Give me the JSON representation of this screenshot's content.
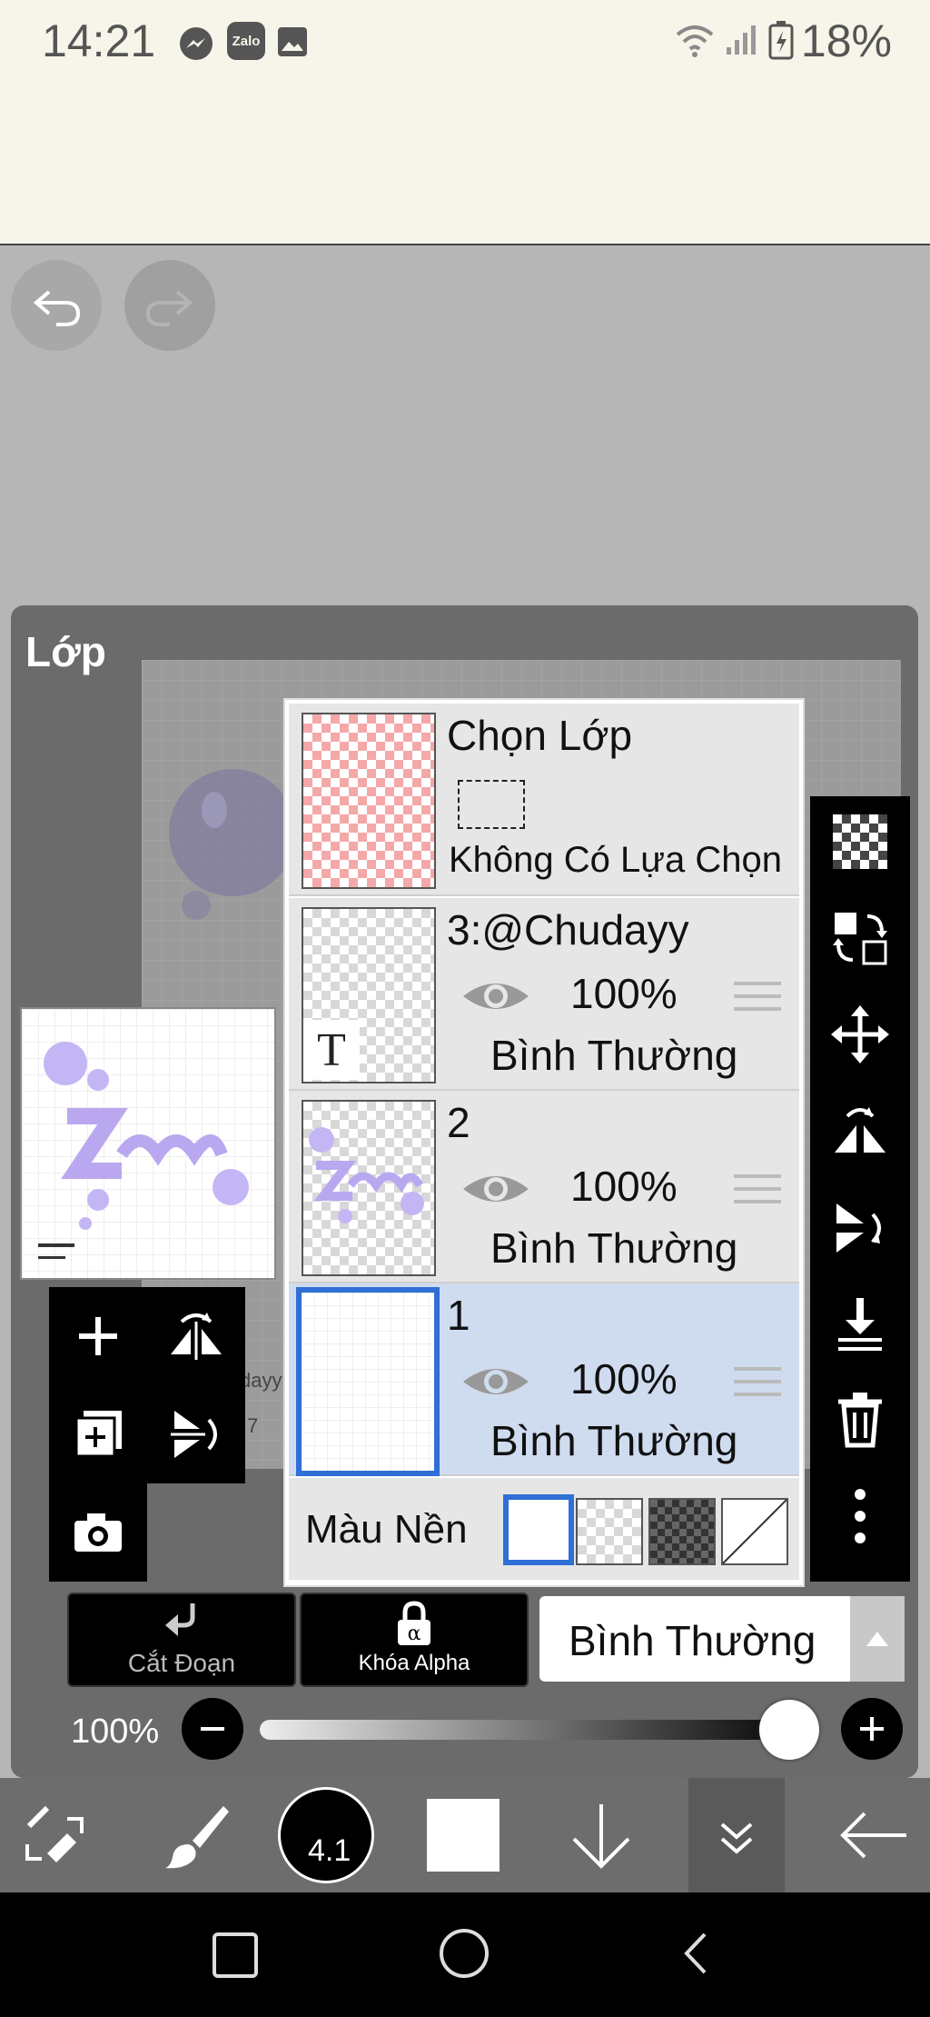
{
  "status_bar": {
    "time": "14:21",
    "notification_icons": [
      "messenger-icon",
      "zalo-icon",
      "gallery-icon"
    ],
    "zalo_label": "Zalo",
    "battery": "18%"
  },
  "panel": {
    "title": "Lớp"
  },
  "selection_row": {
    "title": "Chọn Lớp",
    "subtitle": "Không Có Lựa Chọn"
  },
  "layers": [
    {
      "name": "3:@Chudayy",
      "opacity": "100%",
      "blend": "Bình Thường",
      "thumb_glyph": "T",
      "selected": false
    },
    {
      "name": "2",
      "opacity": "100%",
      "blend": "Bình Thường",
      "selected": false
    },
    {
      "name": "1",
      "opacity": "100%",
      "blend": "Bình Thường",
      "selected": true
    }
  ],
  "background": {
    "label": "Màu Nền"
  },
  "actions": {
    "clip_label": "Cắt Đoạn",
    "alpha_lock_label": "Khóa Alpha",
    "blend_mode": "Bình Thường"
  },
  "opacity_slider": {
    "label": "100%",
    "value": 1.0
  },
  "toolbar": {
    "brush_size": "4.1"
  },
  "canvas_peek": {
    "text1": "dayy",
    "text2": "7"
  },
  "colors": {
    "accent_blue": "#2f6fd6",
    "selected_row": "#cfdcef",
    "panel_bg": "#6b6b6b",
    "status_bg": "#f7f5e9",
    "art_purple": "#b9a8f0"
  }
}
